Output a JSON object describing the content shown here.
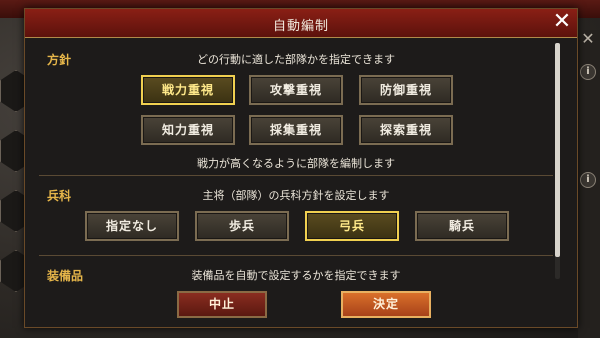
{
  "dialog": {
    "title": "自動編制",
    "close_icon": "close-icon"
  },
  "strategy": {
    "label": "方針",
    "description": "どの行動に適した部隊かを指定できます",
    "options": [
      "戦力重視",
      "攻撃重視",
      "防御重視",
      "知力重視",
      "採集重視",
      "探索重視"
    ],
    "selected": "戦力重視",
    "note": "戦力が高くなるように部隊を編制します"
  },
  "troop_type": {
    "label": "兵科",
    "description": "主将（部隊）の兵科方針を設定します",
    "options": [
      "指定なし",
      "歩兵",
      "弓兵",
      "騎兵"
    ],
    "selected": "弓兵"
  },
  "equipment": {
    "label": "装備品",
    "description": "装備品を自動で設定するかを指定できます"
  },
  "footer": {
    "cancel_label": "中止",
    "confirm_label": "決定"
  },
  "background": {
    "close_glyph": "✕",
    "info_glyph": "i"
  },
  "colors": {
    "title_bar": "#8a1f15",
    "section_label": "#e6b64a",
    "selected_border": "#f0d050",
    "confirm_button": "#d9702a",
    "cancel_button": "#8a2d20"
  }
}
